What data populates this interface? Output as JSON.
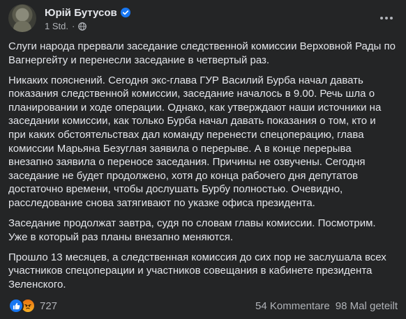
{
  "post": {
    "author": "Юрій Бутусов",
    "timestamp": "1 Std.",
    "separator": "·",
    "paragraphs": [
      "Слуги народа прервали заседание следственной комиссии Верховной Рады по\nВагнергейту и перенесли заседание в четвертый раз.",
      "Никаких пояснений. Сегодня экс-глава ГУР Василий Бурба начал давать\nпоказания следственной комиссии, заседание началось в 9.00. Речь шла о\nпланировании и ходе операции. Однако, как утверждают наши источники на\nзаседании комиссии, как только Бурба начал давать показания о том, кто и\nпри каких обстоятельствах дал команду перенести спецоперацию, глава\nкомиссии Марьяна Безуглая заявила о перерыве. А в конце перерыва\nвнезапно заявила о переносе заседания. Причины не озвучены. Сегодня\nзаседание не будет продолжено, хотя до конца рабочего дня депутатов\nдостаточно времени, чтобы дослушать Бурбу полностью. Очевидно,\nрасследование снова затягивают по указке офиса президента.",
      "Заседание продолжат завтра, судя по словам главы комиссии. Посмотрим.\nУже в который раз планы внезапно меняются.",
      "Прошло 13 месяцев, а следственная комиссия до сих пор не  заслушала всех\nучастников спецоперации и участников совещания в кабинете президента\nЗеленского."
    ]
  },
  "footer": {
    "reaction_count": "727",
    "comments": "54 Kommentare",
    "shares": "98 Mal geteilt"
  },
  "icons": {
    "verified": "verified-badge-icon",
    "audience": "globe-icon",
    "more": "more-options-icon",
    "reaction_like": "like-icon",
    "reaction_angry": "angry-icon"
  },
  "colors": {
    "background": "#242526",
    "text": "#e4e6eb",
    "secondary_text": "#b0b3b8",
    "verified_blue": "#1877f2"
  }
}
